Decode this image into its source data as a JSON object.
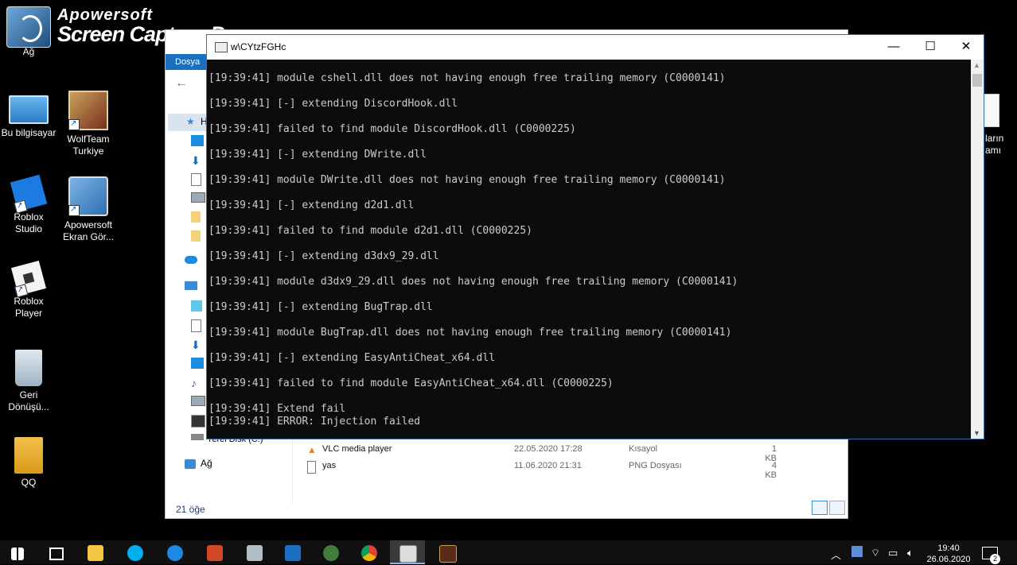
{
  "watermark": {
    "brand": "Apowersoft",
    "product": "Screen Capture Pro"
  },
  "desktop_icons": [
    {
      "label": "Ağ"
    },
    {
      "label": "Bu bilgisayar"
    },
    {
      "label": "WolfTeam Turkiye"
    },
    {
      "label": "Roblox Studio"
    },
    {
      "label": "Apowersoft Ekran Gör..."
    },
    {
      "label": "Roblox Player"
    },
    {
      "label": "Geri Dönüşü..."
    },
    {
      "label": "QQ"
    }
  ],
  "right_peek": {
    "line1": "ların",
    "line2": "amı"
  },
  "explorer": {
    "menu_tab": "Dosya",
    "nav_partial_label": "H",
    "nav_ag": "Ağ",
    "nav_yerel_partial": "Yerel Disk (C:)",
    "files": [
      {
        "name": "VLC media player",
        "date": "22.05.2020 17:28",
        "type": "Kısayol",
        "size": "1 KB"
      },
      {
        "name": "yas",
        "date": "11.06.2020 21:31",
        "type": "PNG Dosyası",
        "size": "4 KB"
      }
    ],
    "status": "21 öğe"
  },
  "console": {
    "title": "w\\CYtzFGHc",
    "controls": {
      "minimize": "—",
      "maximize": "☐",
      "close": "✕"
    },
    "lines": [
      "[19:39:41] module cshell.dll does not having enough free trailing memory (C0000141)",
      "[19:39:41] [-] extending DiscordHook.dll",
      "[19:39:41] failed to find module DiscordHook.dll (C0000225)",
      "[19:39:41] [-] extending DWrite.dll",
      "[19:39:41] module DWrite.dll does not having enough free trailing memory (C0000141)",
      "[19:39:41] [-] extending d2d1.dll",
      "[19:39:41] failed to find module d2d1.dll (C0000225)",
      "[19:39:41] [-] extending d3dx9_29.dll",
      "[19:39:41] module d3dx9_29.dll does not having enough free trailing memory (C0000141)",
      "[19:39:41] [-] extending BugTrap.dll",
      "[19:39:41] module BugTrap.dll does not having enough free trailing memory (C0000141)",
      "[19:39:41] [-] extending EasyAntiCheat_x64.dll",
      "[19:39:41] failed to find module EasyAntiCheat_x64.dll (C0000225)",
      "[19:39:41] Extend fail",
      "[19:39:41] ERROR: Injection failed"
    ]
  },
  "taskbar": {
    "apps": [
      "start",
      "task-view",
      "file-explorer",
      "skype",
      "edge",
      "powerpoint",
      "network-tool",
      "mail",
      "game-launcher",
      "chrome",
      "console-window",
      "wolfteam"
    ],
    "clock_time": "19:40",
    "clock_date": "26.06.2020",
    "notification_count": "2",
    "colors": {
      "accent": "#8ab4e8",
      "bar": "#101010"
    }
  }
}
